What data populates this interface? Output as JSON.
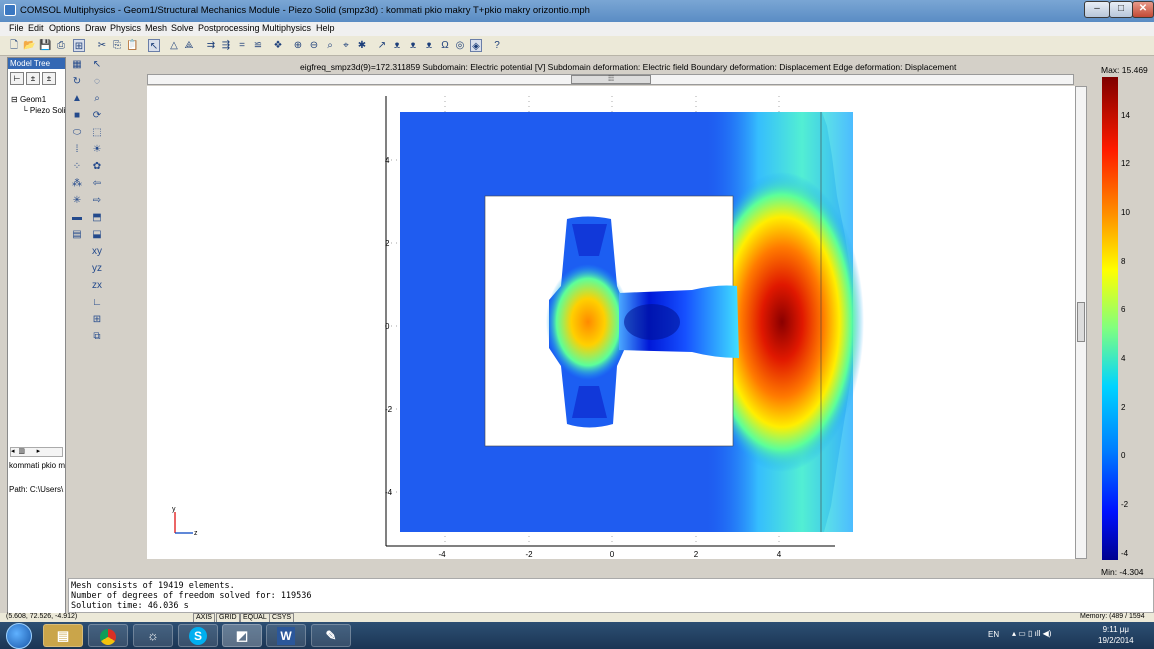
{
  "window": {
    "title": "COMSOL Multiphysics - Geom1/Structural Mechanics Module - Piezo Solid (smpz3d) : kommati pkio makry T+pkio makry orizontio.mph"
  },
  "menu": [
    "File",
    "Edit",
    "Options",
    "Draw",
    "Physics",
    "Mesh",
    "Solve",
    "Postprocessing",
    "Multiphysics",
    "Help"
  ],
  "model_tree": {
    "header": "Model Tree",
    "nodes": [
      "Geom1",
      "Piezo Soli"
    ],
    "info": "kommati pkio m:",
    "path": "Path: C:\\Users\\"
  },
  "plot": {
    "info": "eigfreq_smpz3d(9)=172.311859   Subdomain: Electric potential [V]   Subdomain deformation: Electric field   Boundary deformation: Displacement   Edge deformation: Displacement",
    "x_ticks": [
      "-4",
      "-2",
      "0",
      "2",
      "4"
    ],
    "y_ticks": [
      "4",
      "2",
      "0",
      "-2",
      "-4"
    ],
    "axis_labels": {
      "y": "y",
      "z": "z"
    }
  },
  "colorbar": {
    "max_label": "Max: 15.469",
    "min_label": "Min: -4.304",
    "ticks": [
      "14",
      "12",
      "10",
      "8",
      "6",
      "4",
      "2",
      "0",
      "-2",
      "-4"
    ]
  },
  "console": [
    "Mesh consists of 19419 elements.",
    "Number of degrees of freedom solved for: 119536",
    "Solution time: 46.036 s"
  ],
  "status": {
    "coords": "(5.608, 72.526, -4.912)",
    "buttons": [
      "AXIS",
      "GRID",
      "EQUAL",
      "CSYS"
    ],
    "memory": "Memory: (489 / 1594"
  },
  "taskbar": {
    "language": "EN",
    "time": "9:11 μμ",
    "date": "19/2/2014",
    "apps": [
      "explorer",
      "chrome",
      "app",
      "skype",
      "comsol",
      "word",
      "paint"
    ]
  }
}
